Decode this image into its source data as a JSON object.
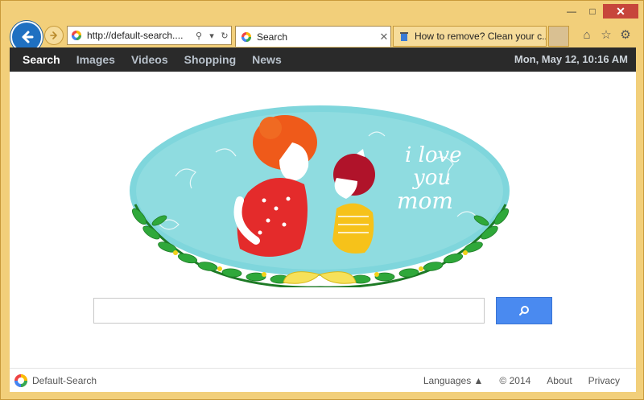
{
  "window": {
    "minimize": "—",
    "maximize": "□",
    "close": "✕"
  },
  "address": {
    "url": "http://default-search...."
  },
  "tabs": [
    {
      "label": "Search",
      "close": "✕"
    },
    {
      "label": "How to remove? Clean your c..."
    }
  ],
  "nav": {
    "items": [
      {
        "label": "Search"
      },
      {
        "label": "Images"
      },
      {
        "label": "Videos"
      },
      {
        "label": "Shopping"
      },
      {
        "label": "News"
      }
    ],
    "datetime": "Mon, May 12, 10:16 AM"
  },
  "doodle": {
    "text_lines": [
      "i love",
      "you",
      "mom"
    ]
  },
  "search": {
    "placeholder": ""
  },
  "footer": {
    "brand": "Default-Search",
    "languages": "Languages ▲",
    "copyright": "© 2014",
    "about": "About",
    "privacy": "Privacy"
  },
  "colors": {
    "accent": "#4a8af0",
    "topbar": "#2a2a2a",
    "frame": "#f2cf7a",
    "back_button": "#1f70c1"
  }
}
